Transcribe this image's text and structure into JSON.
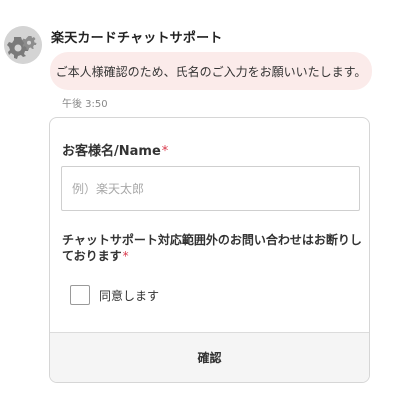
{
  "chat": {
    "sender_name": "楽天カードチャットサポート",
    "avatar_icon": "gear-icon",
    "message": "ご本人様確認のため、氏名のご入力をお願いいたします。",
    "timestamp": "午後 3:50"
  },
  "form": {
    "name_label": "お客様名/Name",
    "required_mark": "*",
    "name_value": "",
    "name_placeholder": "例）楽天太郎",
    "notice_text": "チャットサポート対応範囲外のお問い合わせはお断りしております",
    "agree_checked": false,
    "agree_label": "同意します",
    "confirm_label": "確認"
  },
  "colors": {
    "bubble_background": "#fbebea",
    "required_mark": "#d9384a",
    "confirm_background": "#f5f5f5"
  }
}
